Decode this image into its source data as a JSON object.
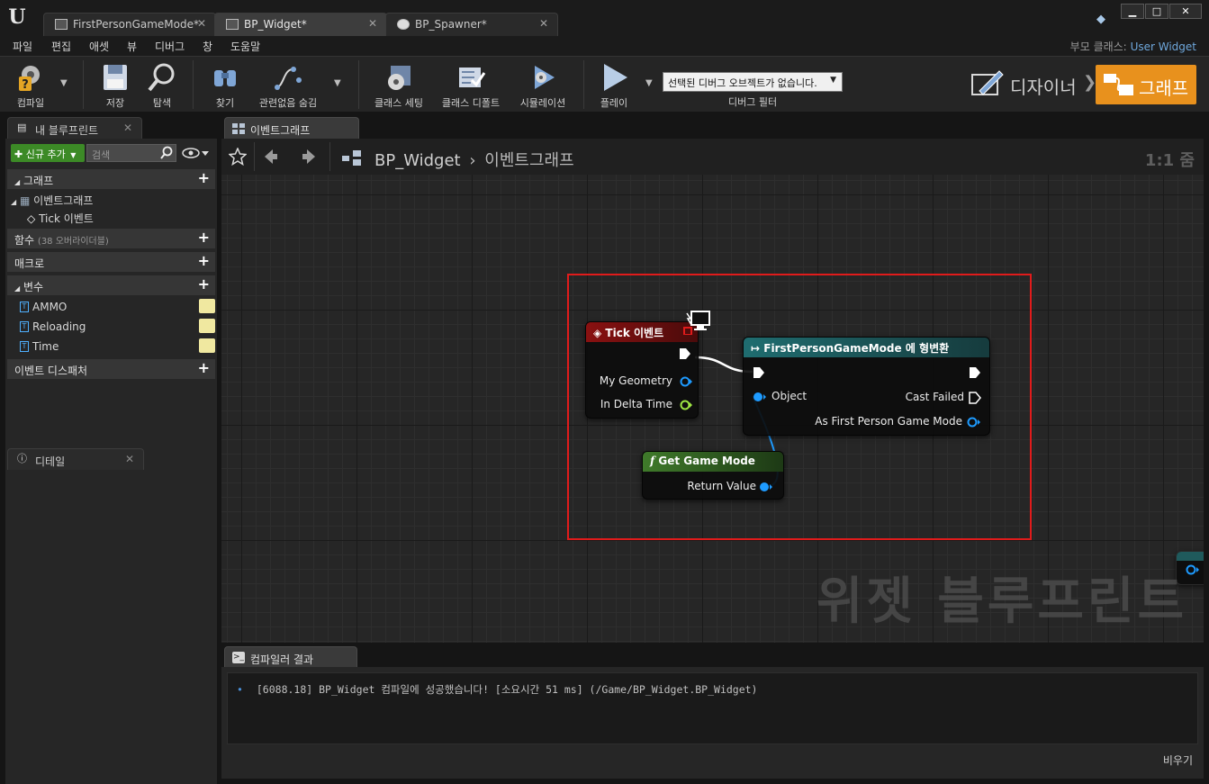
{
  "titlebar": {
    "tabs": [
      {
        "label": "FirstPersonGameMode*",
        "active": false
      },
      {
        "label": "BP_Widget*",
        "active": true
      },
      {
        "label": "BP_Spawner*",
        "active": false
      }
    ]
  },
  "menu": {
    "items": [
      "파일",
      "편집",
      "애셋",
      "뷰",
      "디버그",
      "창",
      "도움말"
    ],
    "parent_class_label": "부모 클래스:",
    "parent_class_value": "User Widget"
  },
  "toolbar": {
    "compile": "컴파일",
    "save": "저장",
    "browse": "탐색",
    "find": "찾기",
    "hide_unrelated": "관련없음 숨김",
    "class_settings": "클래스 세팅",
    "class_defaults": "클래스 디폴트",
    "simulation": "시뮬레이션",
    "play": "플레이",
    "debug_select": "선택된 디버그 오브젝트가 없습니다.",
    "debug_filter": "디버그 필터",
    "designer": "디자이너",
    "graph": "그래프"
  },
  "my_blueprint": {
    "tab_label": "내 블루프린트",
    "add_new": "신규 추가",
    "search_placeholder": "검색",
    "categories": {
      "graphs": "그래프",
      "event_graph": "이벤트그래프",
      "tick_event": "Tick 이벤트",
      "functions": "함수",
      "functions_sub": "(38 오버라이더블)",
      "macros": "매크로",
      "variables": "변수",
      "event_dispatchers": "이벤트 디스패처"
    },
    "variables": [
      "AMMO",
      "Reloading",
      "Time"
    ]
  },
  "details": {
    "tab_label": "디테일"
  },
  "graph_editor": {
    "tab_label": "이벤트그래프",
    "breadcrumb_root": "BP_Widget",
    "breadcrumb_current": "이벤트그래프",
    "zoom": "1:1 줌",
    "watermark": "위젯 블루프린트"
  },
  "nodes": {
    "tick": {
      "title": "Tick 이벤트",
      "pins": [
        "My Geometry",
        "In Delta Time"
      ]
    },
    "cast": {
      "title": "FirstPersonGameMode 에 형변환",
      "input_pin": "Object",
      "output_pins": [
        "Cast Failed",
        "As First Person Game Mode"
      ]
    },
    "get_game_mode": {
      "title": "Get Game Mode",
      "output_pin": "Return Value"
    }
  },
  "colors": {
    "accent_orange": "#e8911d",
    "event_header": "#8a1111",
    "cast_header": "#1f6d70",
    "function_header": "#2f5a20",
    "selection": "#e01b1b",
    "object_pin": "#1e9bff",
    "float_pin": "#9fe844"
  },
  "compiler_results": {
    "tab_label": "컴파일러 결과",
    "log": "[6088.18] BP_Widget 컴파일에 성공했습니다! [소요시간 51 ms] (/Game/BP_Widget.BP_Widget)",
    "clear": "비우기"
  }
}
